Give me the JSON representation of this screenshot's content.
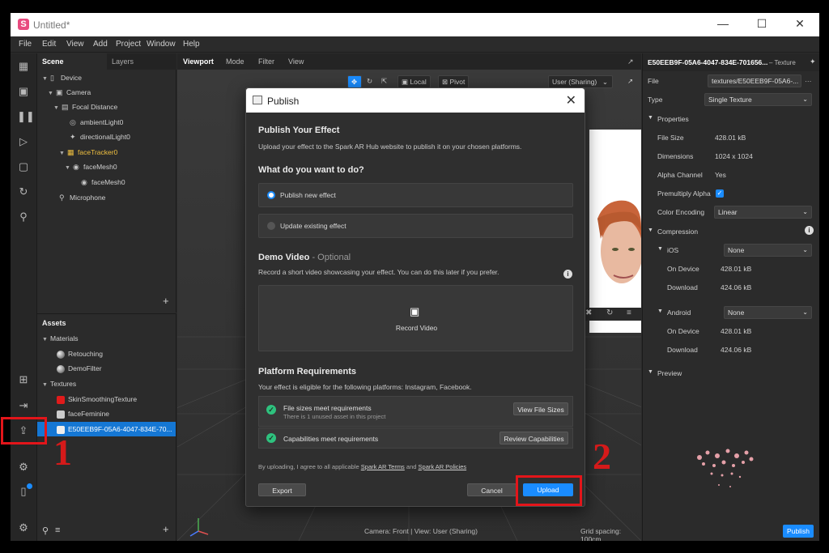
{
  "window": {
    "title": "Untitled*",
    "controls": [
      "minimize",
      "maximize",
      "close"
    ]
  },
  "menu": [
    "File",
    "Edit",
    "View",
    "Add",
    "Project",
    "Window",
    "Help"
  ],
  "scene_panel": {
    "tabs": [
      "Scene",
      "Layers"
    ],
    "tree": [
      {
        "label": "Device",
        "icon": "device-icon"
      },
      {
        "label": "Camera",
        "icon": "camera-icon"
      },
      {
        "label": "Focal Distance",
        "icon": "focal-icon"
      },
      {
        "label": "ambientLight0",
        "icon": "light-icon"
      },
      {
        "label": "directionalLight0",
        "icon": "light-icon"
      },
      {
        "label": "faceTracker0",
        "icon": "facetracker-icon"
      },
      {
        "label": "faceMesh0",
        "icon": "mesh-icon"
      },
      {
        "label": "faceMesh0",
        "icon": "mesh-icon"
      },
      {
        "label": "Microphone",
        "icon": "microphone-icon"
      }
    ],
    "add": "+"
  },
  "assets_panel": {
    "title": "Assets",
    "materials_label": "Materials",
    "materials": [
      "Retouching",
      "DemoFilter"
    ],
    "textures_label": "Textures",
    "textures": [
      "SkinSmoothingTexture",
      "faceFeminine",
      "E50EEB9F-05A6-4047-834E-70..."
    ],
    "add": "+"
  },
  "viewport": {
    "tabs": [
      "Viewport",
      "Mode",
      "Filter",
      "View"
    ],
    "local_label": "Local",
    "pivot_label": "Pivot",
    "user_label": "User (Sharing)",
    "footer_camera": "Camera: Front | View: User (Sharing)",
    "footer_grid": "Grid spacing: 100cm"
  },
  "properties": {
    "title": "E50EEB9F-05A6-4047-834E-701656...",
    "type_suffix": "– Texture",
    "file_label": "File",
    "file_value": "textures/E50EEB9F-05A6-...",
    "type_label": "Type",
    "type_value": "Single Texture",
    "properties_section": "Properties",
    "file_size_label": "File Size",
    "file_size_value": "428.01 kB",
    "dimensions_label": "Dimensions",
    "dimensions_value": "1024 x 1024",
    "alpha_label": "Alpha Channel",
    "alpha_value": "Yes",
    "premultiply_label": "Premultiply Alpha",
    "color_encoding_label": "Color Encoding",
    "color_encoding_value": "Linear",
    "compression_section": "Compression",
    "ios_label": "iOS",
    "ios_value": "None",
    "ios_on_device_label": "On Device",
    "ios_on_device_value": "428.01 kB",
    "ios_download_label": "Download",
    "ios_download_value": "424.06 kB",
    "android_label": "Android",
    "android_value": "None",
    "android_on_device_label": "On Device",
    "android_on_device_value": "428.01 kB",
    "android_download_label": "Download",
    "android_download_value": "424.06 kB",
    "preview_section": "Preview",
    "publish_button": "Publish"
  },
  "publish_dialog": {
    "title": "Publish",
    "heading": "Publish Your Effect",
    "intro": "Upload your effect to the Spark AR Hub website to publish it on your chosen platforms.",
    "question": "What do you want to do?",
    "option_new": "Publish new effect",
    "option_update": "Update existing effect",
    "demo_heading": "Demo Video",
    "demo_optional": "- Optional",
    "demo_text": "Record a short video showcasing your effect. You can do this later if you prefer.",
    "record_label": "Record Video",
    "req_heading": "Platform Requirements",
    "req_text": "Your effect is eligible for the following platforms: Instagram, Facebook.",
    "req1_title": "File sizes meet requirements",
    "req1_sub": "There is 1 unused asset in this project",
    "req1_button": "View File Sizes",
    "req2_title": "Capabilities meet requirements",
    "req2_button": "Review Capabilities",
    "legal_prefix": "By uploading, I agree to all applicable",
    "legal_link1": "Spark AR Terms",
    "legal_and": "and",
    "legal_link2": "Spark AR Policies",
    "export_button": "Export",
    "cancel_button": "Cancel",
    "upload_button": "Upload"
  },
  "annotations": {
    "step1": "1",
    "step2": "2"
  },
  "colors": {
    "accent": "#1a8cff",
    "annotation_red": "#e3151a",
    "success": "#2ec27e",
    "selection": "#1577d4"
  }
}
